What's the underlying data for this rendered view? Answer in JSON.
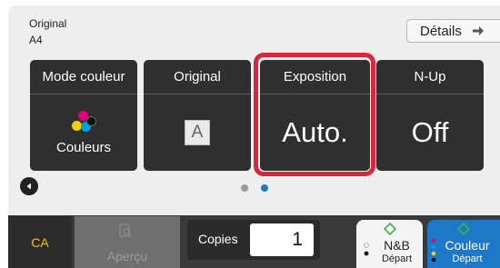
{
  "original_info": {
    "label": "Original",
    "size": "A4"
  },
  "details_button": {
    "label": "Détails",
    "icon": "arrow-right-icon"
  },
  "tiles": [
    {
      "title": "Mode couleur",
      "value": "Couleurs",
      "icon": "color-dots-icon"
    },
    {
      "title": "Original",
      "value": "A",
      "icon": "original-a-icon"
    },
    {
      "title": "Exposition",
      "value": "Auto.",
      "selected": true
    },
    {
      "title": "N-Up",
      "value": "Off"
    }
  ],
  "pager": {
    "page_count": 2,
    "current_page": 2
  },
  "bottom": {
    "ca_label": "CA",
    "preview_label": "Aperçu",
    "copies_label": "Copies",
    "copies_value": "1",
    "start_bw": {
      "main": "N&B",
      "sub": "Départ"
    },
    "start_color": {
      "main": "Couleur",
      "sub": "Départ"
    }
  },
  "colors": {
    "tile_bg": "#2f2f2f",
    "highlight": "#d7263d",
    "ca_text": "#f2c200",
    "start_color_bg": "#1e78c8",
    "start_icon_green": "#3cb44a",
    "pager_active": "#1e78c8"
  }
}
